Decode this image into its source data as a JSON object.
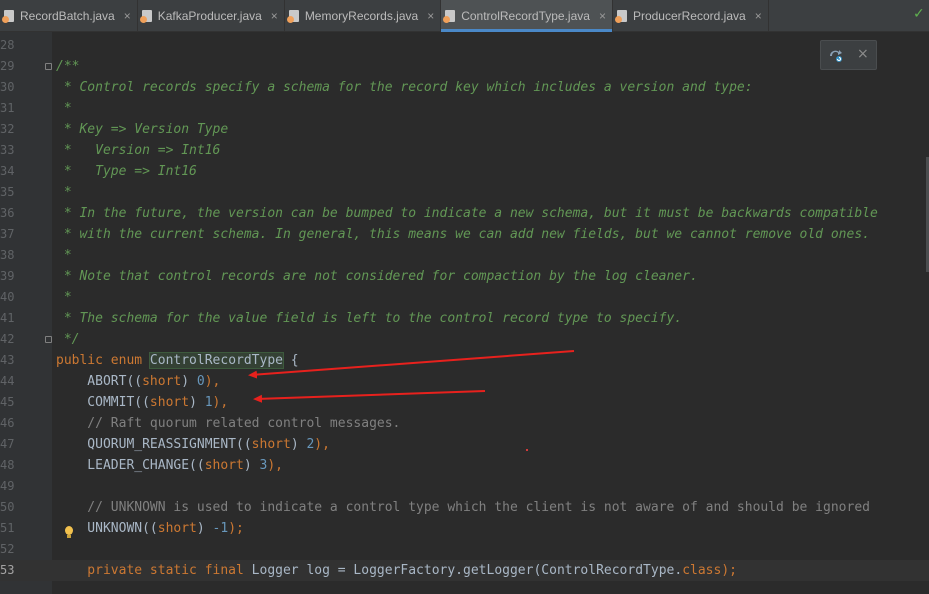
{
  "tabs": [
    {
      "label": "RecordBatch.java",
      "active": false
    },
    {
      "label": "KafkaProducer.java",
      "active": false
    },
    {
      "label": "MemoryRecords.java",
      "active": false
    },
    {
      "label": "ControlRecordType.java",
      "active": true
    },
    {
      "label": "ProducerRecord.java",
      "active": false
    }
  ],
  "tab_close_glyph": "×",
  "status": {
    "check_glyph": "✓"
  },
  "popup": {
    "close_glyph": "×",
    "icon": "refresh-maven-icon"
  },
  "editor": {
    "current_line": 53,
    "lines": [
      {
        "n": "28",
        "tokens": []
      },
      {
        "n": "29",
        "tokens": [
          {
            "t": "/**",
            "c": "doc"
          }
        ]
      },
      {
        "n": "30",
        "tokens": [
          {
            "t": " * Control records specify a schema for the record key which includes a version and type:",
            "c": "doc"
          }
        ]
      },
      {
        "n": "31",
        "tokens": [
          {
            "t": " *",
            "c": "doc"
          }
        ]
      },
      {
        "n": "32",
        "tokens": [
          {
            "t": " * Key => Version Type",
            "c": "doc"
          }
        ]
      },
      {
        "n": "33",
        "tokens": [
          {
            "t": " *   Version => Int16",
            "c": "doc"
          }
        ]
      },
      {
        "n": "34",
        "tokens": [
          {
            "t": " *   Type => Int16",
            "c": "doc"
          }
        ]
      },
      {
        "n": "35",
        "tokens": [
          {
            "t": " *",
            "c": "doc"
          }
        ]
      },
      {
        "n": "36",
        "tokens": [
          {
            "t": " * In the future, the version can be bumped to indicate a new schema, but it must be backwards compatible",
            "c": "doc"
          }
        ]
      },
      {
        "n": "37",
        "tokens": [
          {
            "t": " * with the current schema. In general, this means we can add new fields, but we cannot remove old ones.",
            "c": "doc"
          }
        ]
      },
      {
        "n": "38",
        "tokens": [
          {
            "t": " *",
            "c": "doc"
          }
        ]
      },
      {
        "n": "39",
        "tokens": [
          {
            "t": " * Note that control records are not considered for compaction by the log cleaner.",
            "c": "doc"
          }
        ]
      },
      {
        "n": "40",
        "tokens": [
          {
            "t": " *",
            "c": "doc"
          }
        ]
      },
      {
        "n": "41",
        "tokens": [
          {
            "t": " * The schema for the value field is left to the control record type to specify.",
            "c": "doc"
          }
        ]
      },
      {
        "n": "42",
        "tokens": [
          {
            "t": " */",
            "c": "doc"
          }
        ]
      },
      {
        "n": "43",
        "tokens": [
          {
            "t": "public enum ",
            "c": "kw"
          },
          {
            "t": "ControlRecordType",
            "c": "hl"
          },
          {
            "t": " {",
            "c": "plain"
          }
        ]
      },
      {
        "n": "44",
        "tokens": [
          {
            "t": "    ABORT((",
            "c": "plain"
          },
          {
            "t": "short",
            "c": "kw"
          },
          {
            "t": ") ",
            "c": "plain"
          },
          {
            "t": "0",
            "c": "num"
          },
          {
            "t": "),",
            "c": "kw"
          }
        ]
      },
      {
        "n": "45",
        "tokens": [
          {
            "t": "    COMMIT((",
            "c": "plain"
          },
          {
            "t": "short",
            "c": "kw"
          },
          {
            "t": ") ",
            "c": "plain"
          },
          {
            "t": "1",
            "c": "num"
          },
          {
            "t": "),",
            "c": "kw"
          }
        ]
      },
      {
        "n": "46",
        "tokens": [
          {
            "t": "    // Raft quorum related control messages.",
            "c": "cmt"
          }
        ]
      },
      {
        "n": "47",
        "tokens": [
          {
            "t": "    QUORUM_REASSIGNMENT((",
            "c": "plain"
          },
          {
            "t": "short",
            "c": "kw"
          },
          {
            "t": ") ",
            "c": "plain"
          },
          {
            "t": "2",
            "c": "num"
          },
          {
            "t": "),",
            "c": "kw"
          }
        ]
      },
      {
        "n": "48",
        "tokens": [
          {
            "t": "    LEADER_CHANGE((",
            "c": "plain"
          },
          {
            "t": "short",
            "c": "kw"
          },
          {
            "t": ") ",
            "c": "plain"
          },
          {
            "t": "3",
            "c": "num"
          },
          {
            "t": "),",
            "c": "kw"
          }
        ]
      },
      {
        "n": "49",
        "tokens": []
      },
      {
        "n": "50",
        "tokens": [
          {
            "t": "    // UNKNOWN is used to indicate a control type which the client is not aware of and should be ignored",
            "c": "cmt"
          }
        ]
      },
      {
        "n": "51",
        "tokens": [
          {
            "t": "    UNKNOWN((",
            "c": "plain"
          },
          {
            "t": "short",
            "c": "kw"
          },
          {
            "t": ") ",
            "c": "plain"
          },
          {
            "t": "-1",
            "c": "num"
          },
          {
            "t": ");",
            "c": "kw"
          }
        ]
      },
      {
        "n": "52",
        "tokens": []
      },
      {
        "n": "53",
        "tokens": [
          {
            "t": "    private static final ",
            "c": "kw"
          },
          {
            "t": "Logger ",
            "c": "plain"
          },
          {
            "t": "log",
            "c": "plain"
          },
          {
            "t": " = LoggerFactory.",
            "c": "plain"
          },
          {
            "t": "getLogger",
            "c": "plain"
          },
          {
            "t": "(ControlRecordType.",
            "c": "plain"
          },
          {
            "t": "class",
            "c": "kw"
          },
          {
            "t": ");",
            "c": "kw"
          }
        ]
      }
    ]
  },
  "colors": {
    "background": "#2b2b2b",
    "doc_comment": "#629755",
    "keyword": "#cc7832",
    "number": "#6897bb",
    "comment": "#808080",
    "text": "#a9b7c6",
    "annotation_arrow": "#e8211d",
    "active_tab_underline": "#4a88c7"
  }
}
